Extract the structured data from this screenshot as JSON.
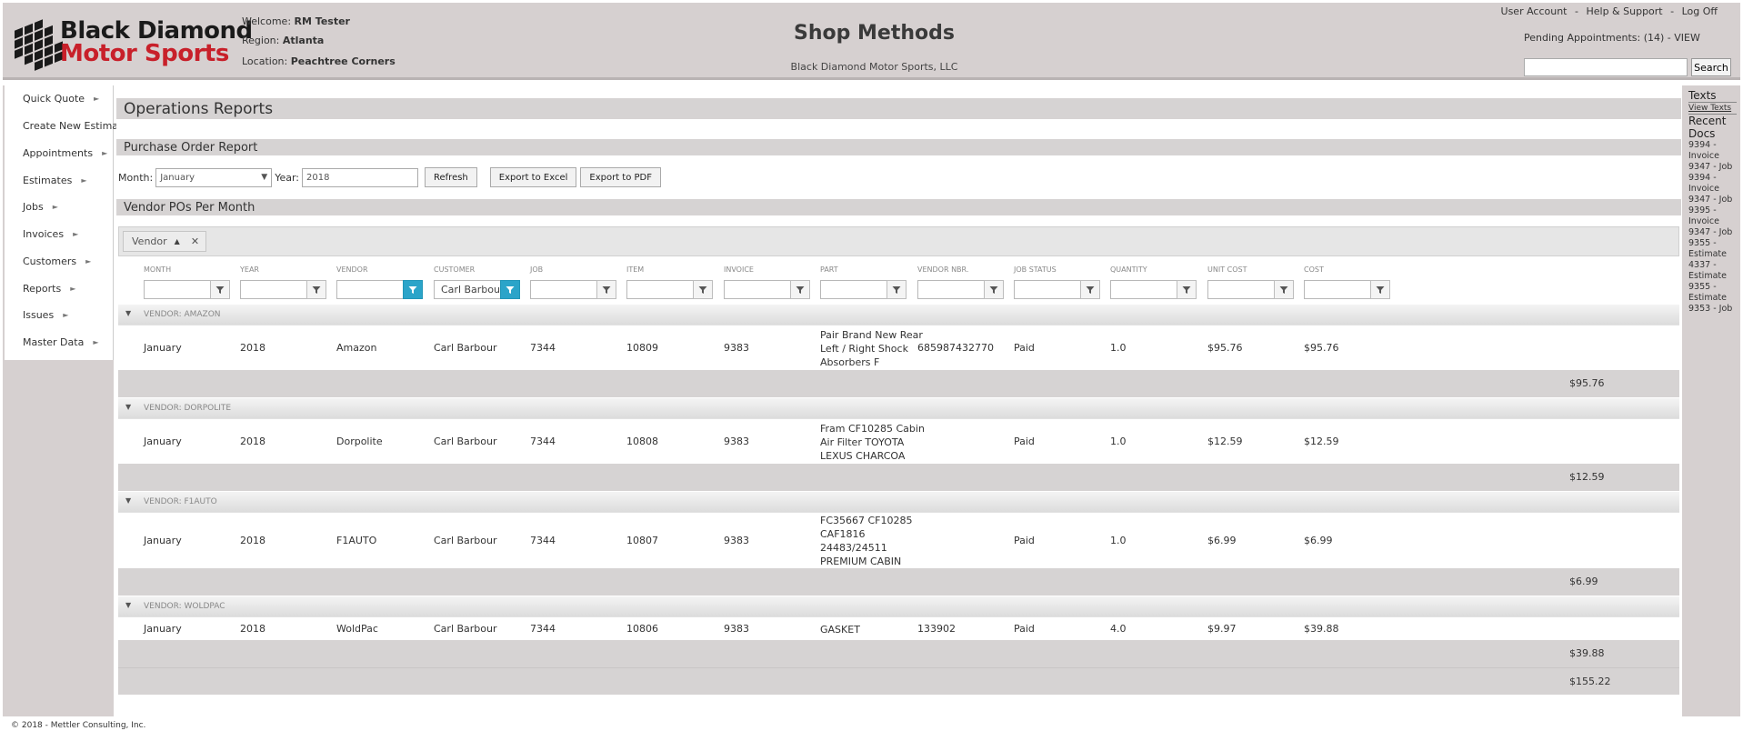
{
  "header": {
    "logo_line1": "Black Diamond",
    "logo_line2": "Motor Sports",
    "welcome_label": "Welcome:",
    "welcome_value": "RM Tester",
    "region_label": "Region:",
    "region_value": "Atlanta",
    "location_label": "Location:",
    "location_value": "Peachtree Corners",
    "title": "Shop Methods",
    "company": "Black Diamond Motor Sports, LLC",
    "links": [
      "User Account",
      "Help & Support",
      "Log Off"
    ],
    "link_separator": "-",
    "pending": "Pending Appointments: (14) - VIEW",
    "search_button": "Search",
    "search_value": ""
  },
  "menu": {
    "items": [
      {
        "label": "Quick Quote",
        "arrow": true
      },
      {
        "label": "Create New Estimate",
        "arrow": false
      },
      {
        "label": "Appointments",
        "arrow": true
      },
      {
        "label": "Estimates",
        "arrow": true
      },
      {
        "label": "Jobs",
        "arrow": true
      },
      {
        "label": "Invoices",
        "arrow": true
      },
      {
        "label": "Customers",
        "arrow": true
      },
      {
        "label": "Reports",
        "arrow": true
      },
      {
        "label": "Issues",
        "arrow": true
      },
      {
        "label": "Master Data",
        "arrow": true
      }
    ]
  },
  "rightbar": {
    "texts_title": "Texts",
    "view_texts": "View Texts",
    "recent_docs_line1": "Recent",
    "recent_docs_line2": "Docs",
    "docs": [
      "9394 -",
      "Invoice",
      "9347 - Job",
      "9394 -",
      "Invoice",
      "9347 - Job",
      "9395 -",
      "Invoice",
      "9347 - Job",
      "9355 -",
      "Estimate",
      "4337 -",
      "Estimate",
      "9355 -",
      "Estimate",
      "9353 - Job"
    ]
  },
  "main": {
    "page_title": "Operations Reports",
    "report_title": "Purchase Order Report",
    "month_label": "Month:",
    "month_value": "January",
    "year_label": "Year:",
    "year_value": "2018",
    "refresh_button": "Refresh",
    "export_excel_button": "Export to Excel",
    "export_pdf_button": "Export to PDF",
    "grid_title": "Vendor POs Per Month",
    "group_chip": "Vendor",
    "columns": [
      "MONTH",
      "YEAR",
      "VENDOR",
      "CUSTOMER",
      "JOB",
      "ITEM",
      "INVOICE",
      "PART",
      "VENDOR NBR.",
      "JOB STATUS",
      "QUANTITY",
      "UNIT COST",
      "COST"
    ],
    "filters": [
      "",
      "",
      "",
      "Carl Barbour",
      "",
      "",
      "",
      "",
      "",
      "",
      "",
      "",
      ""
    ],
    "active_filters": [
      false,
      false,
      true,
      true,
      false,
      false,
      false,
      false,
      false,
      false,
      false,
      false,
      false
    ],
    "groups": [
      {
        "label": "VENDOR: AMAZON",
        "row": [
          "January",
          "2018",
          "Amazon",
          "Carl Barbour",
          "7344",
          "10809",
          "9383",
          [
            "Pair Brand New Rear",
            "Left / Right Shock",
            "Absorbers F"
          ],
          "685987432770",
          "Paid",
          "1.0",
          "$95.76",
          "$95.76"
        ],
        "subtotal": "$95.76"
      },
      {
        "label": "VENDOR: DORPOLITE",
        "row": [
          "January",
          "2018",
          "Dorpolite",
          "Carl Barbour",
          "7344",
          "10808",
          "9383",
          [
            "Fram CF10285 Cabin",
            "Air Filter TOYOTA",
            "LEXUS CHARCOA"
          ],
          "",
          "Paid",
          "1.0",
          "$12.59",
          "$12.59"
        ],
        "subtotal": "$12.59"
      },
      {
        "label": "VENDOR: F1AUTO",
        "row": [
          "January",
          "2018",
          "F1AUTO",
          "Carl Barbour",
          "7344",
          "10807",
          "9383",
          [
            "FC35667 CF10285",
            "CAF1816",
            "24483/24511",
            "PREMIUM CABIN"
          ],
          "",
          "Paid",
          "1.0",
          "$6.99",
          "$6.99"
        ],
        "subtotal": "$6.99"
      },
      {
        "label": "VENDOR: WOLDPAC",
        "row": [
          "January",
          "2018",
          "WoldPac",
          "Carl Barbour",
          "7344",
          "10806",
          "9383",
          [
            "GASKET"
          ],
          "133902",
          "Paid",
          "4.0",
          "$9.97",
          "$39.88"
        ],
        "subtotal": "$39.88"
      }
    ],
    "grand_total": "$155.22"
  },
  "footer": {
    "copyright": "© 2018 - Mettler Consulting, Inc."
  },
  "colors": {
    "chrome": "#d6d0d0",
    "accent_filter": "#2ba4c9",
    "logo_red": "#c8202a"
  },
  "icons": [
    "filter-icon",
    "caret-down-icon",
    "chevron-right-icon",
    "sort-ascending-icon",
    "close-icon",
    "diamond-grid-logo"
  ]
}
